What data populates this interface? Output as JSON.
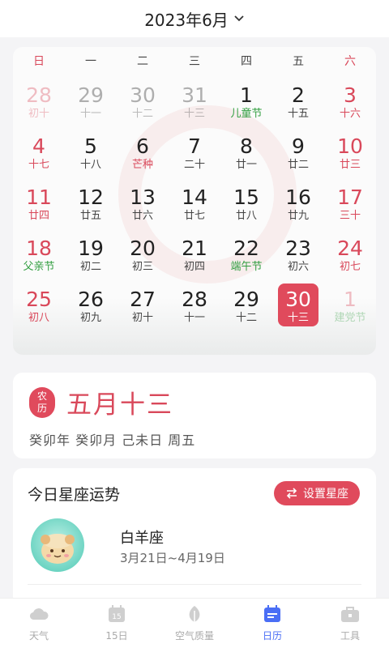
{
  "header": {
    "title": "2023年6月"
  },
  "weekdays": [
    "日",
    "一",
    "二",
    "三",
    "四",
    "五",
    "六"
  ],
  "days": [
    {
      "num": "28",
      "lunar": "初十"
    },
    {
      "num": "29",
      "lunar": "十一"
    },
    {
      "num": "30",
      "lunar": "十二"
    },
    {
      "num": "31",
      "lunar": "十三"
    },
    {
      "num": "1",
      "lunar": "儿童节"
    },
    {
      "num": "2",
      "lunar": "十五"
    },
    {
      "num": "3",
      "lunar": "十六"
    },
    {
      "num": "4",
      "lunar": "十七"
    },
    {
      "num": "5",
      "lunar": "十八"
    },
    {
      "num": "6",
      "lunar": "芒种"
    },
    {
      "num": "7",
      "lunar": "二十"
    },
    {
      "num": "8",
      "lunar": "廿一"
    },
    {
      "num": "9",
      "lunar": "廿二"
    },
    {
      "num": "10",
      "lunar": "廿三"
    },
    {
      "num": "11",
      "lunar": "廿四"
    },
    {
      "num": "12",
      "lunar": "廿五"
    },
    {
      "num": "13",
      "lunar": "廿六"
    },
    {
      "num": "14",
      "lunar": "廿七"
    },
    {
      "num": "15",
      "lunar": "廿八"
    },
    {
      "num": "16",
      "lunar": "廿九"
    },
    {
      "num": "17",
      "lunar": "三十"
    },
    {
      "num": "18",
      "lunar": "父亲节"
    },
    {
      "num": "19",
      "lunar": "初二"
    },
    {
      "num": "20",
      "lunar": "初三"
    },
    {
      "num": "21",
      "lunar": "初四"
    },
    {
      "num": "22",
      "lunar": "端午节"
    },
    {
      "num": "23",
      "lunar": "初六"
    },
    {
      "num": "24",
      "lunar": "初七"
    },
    {
      "num": "25",
      "lunar": "初八"
    },
    {
      "num": "26",
      "lunar": "初九"
    },
    {
      "num": "27",
      "lunar": "初十"
    },
    {
      "num": "28",
      "lunar": "十一"
    },
    {
      "num": "29",
      "lunar": "十二"
    },
    {
      "num": "30",
      "lunar": "十三"
    },
    {
      "num": "1",
      "lunar": "建党节"
    }
  ],
  "lunar_card": {
    "badge_top": "农",
    "badge_bottom": "历",
    "date": "五月十三",
    "ganzhi": "癸卯年 癸卯月 己未日 周五"
  },
  "zodiac": {
    "title": "今日星座运势",
    "button": "设置星座",
    "name": "白羊座",
    "range": "3月21日~4月19日"
  },
  "tabs": [
    {
      "label": "天气",
      "icon": "cloud-icon"
    },
    {
      "label": "15日",
      "icon": "calendar-15-icon"
    },
    {
      "label": "空气质量",
      "icon": "leaf-icon"
    },
    {
      "label": "日历",
      "icon": "calendar-icon"
    },
    {
      "label": "工具",
      "icon": "toolbox-icon"
    }
  ],
  "colors": {
    "accent": "#e04a5c",
    "festival": "#2f9d3e",
    "tab_active": "#4a6ef5"
  }
}
